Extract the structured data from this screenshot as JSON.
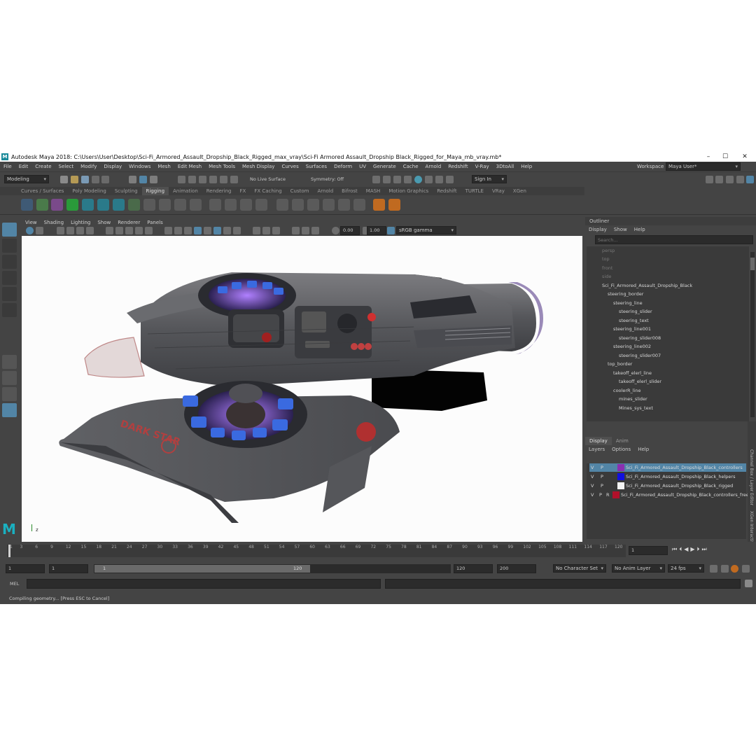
{
  "window": {
    "title": "Autodesk Maya 2018: C:\\Users\\User\\Desktop\\Sci-Fi_Armored_Assault_Dropship_Black_Rigged_max_vray\\Sci-Fi Armored Assault_Dropship Black_Rigged_for_Maya_mb_vray.mb*",
    "controls": [
      "–",
      "☐",
      "✕"
    ]
  },
  "menubar": [
    "File",
    "Edit",
    "Create",
    "Select",
    "Modify",
    "Display",
    "Windows",
    "Mesh",
    "Edit Mesh",
    "Mesh Tools",
    "Mesh Display",
    "Curves",
    "Surfaces",
    "Deform",
    "UV",
    "Generate",
    "Cache",
    "Arnold",
    "Redshift",
    "V-Ray",
    "3DtoAll",
    "Help"
  ],
  "workspace": {
    "label": "Workspace :",
    "value": "Maya User*"
  },
  "statusline": {
    "mode": "Modeling",
    "live_surface": "No Live Surface",
    "symmetry": "Symmetry: Off",
    "signin": "Sign In"
  },
  "shelf_tabs": [
    "Curves / Surfaces",
    "Poly Modeling",
    "Sculpting",
    "Rigging",
    "Animation",
    "Rendering",
    "FX",
    "FX Caching",
    "Custom",
    "Arnold",
    "Bifrost",
    "MASH",
    "Motion Graphics",
    "Redshift",
    "TURTLE",
    "VRay",
    "XGen"
  ],
  "active_shelf_tab": "Rigging",
  "viewport": {
    "menu": [
      "View",
      "Shading",
      "Lighting",
      "Show",
      "Renderer",
      "Panels"
    ],
    "exposure": "0.00",
    "gamma": "1.00",
    "color_space": "sRGB gamma",
    "model_text": "DARK STAR",
    "axis_label": "z"
  },
  "outliner": {
    "title": "Outliner",
    "menu": [
      "Display",
      "Show",
      "Help"
    ],
    "search_placeholder": "Search...",
    "cameras": [
      "persp",
      "top",
      "front",
      "side"
    ],
    "items": [
      {
        "label": "Sci_Fi_Armored_Assault_Dropship_Black",
        "depth": 0
      },
      {
        "label": "steering_border",
        "depth": 1
      },
      {
        "label": "steering_line",
        "depth": 2
      },
      {
        "label": "steering_slider",
        "depth": 3
      },
      {
        "label": "steering_text",
        "depth": 3
      },
      {
        "label": "steering_line001",
        "depth": 2
      },
      {
        "label": "steering_slider008",
        "depth": 3
      },
      {
        "label": "steering_line002",
        "depth": 2
      },
      {
        "label": "steering_slider007",
        "depth": 3
      },
      {
        "label": "top_border",
        "depth": 1
      },
      {
        "label": "takeoff_elerl_line",
        "depth": 2
      },
      {
        "label": "takeoff_elerl_slider",
        "depth": 3
      },
      {
        "label": "coolerR_line",
        "depth": 2
      },
      {
        "label": "mines_slider",
        "depth": 3
      },
      {
        "label": "Mines_sys_text",
        "depth": 3
      }
    ]
  },
  "layer_editor": {
    "tabs": [
      "Display",
      "Anim"
    ],
    "menu": [
      "Layers",
      "Options",
      "Help"
    ],
    "side_tabs": [
      "Channel Box / Layer Editor",
      "XGen Interactive"
    ],
    "layers": [
      {
        "v": "V",
        "p": "P",
        "r": "",
        "color": "#8a2fb0",
        "name": "Sci_Fi_Armored_Assault_Dropship_Black_controllers",
        "selected": true
      },
      {
        "v": "V",
        "p": "P",
        "r": "",
        "color": "#1010e0",
        "name": "Sci_Fi_Armored_Assault_Dropship_Black_helpers",
        "selected": false
      },
      {
        "v": "V",
        "p": "P",
        "r": "",
        "color": "#f4f4f4",
        "name": "Sci_Fi_Armored_Assault_Dropship_Black_rigged",
        "selected": false
      },
      {
        "v": "V",
        "p": "P",
        "r": "R",
        "color": "#b0102a",
        "name": "Sci_Fi_Armored_Assault_Dropship_Black_controllers_freeze",
        "selected": false
      }
    ]
  },
  "timeline": {
    "ticks": [
      "1",
      "3",
      "6",
      "9",
      "12",
      "15",
      "18",
      "21",
      "24",
      "27",
      "30",
      "33",
      "36",
      "39",
      "42",
      "45",
      "48",
      "51",
      "54",
      "57",
      "60",
      "63",
      "66",
      "69",
      "72",
      "75",
      "78",
      "81",
      "84",
      "87",
      "90",
      "93",
      "96",
      "99",
      "102",
      "105",
      "108",
      "111",
      "114",
      "117",
      "120"
    ],
    "current_frame": "1"
  },
  "range": {
    "start": "1",
    "playback_start": "1",
    "slider_start": "1",
    "slider_end": "120",
    "playback_end": "120",
    "end": "200",
    "character_set": "No Character Set",
    "anim_layer": "No Anim Layer",
    "fps": "24 fps"
  },
  "command": {
    "label": "MEL"
  },
  "help_line": "Compiling geometry... [Press ESC to Cancel]",
  "colors": {
    "accent": "#5285a6",
    "background": "#444444",
    "field": "#2b2b2b"
  }
}
